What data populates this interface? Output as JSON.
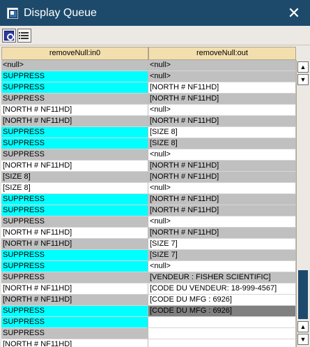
{
  "window": {
    "title": "Display Queue",
    "close_glyph": "✕"
  },
  "toolbar": {
    "buttons": [
      {
        "name": "refresh-icon"
      },
      {
        "name": "list-icon"
      }
    ]
  },
  "table": {
    "columns": [
      "removeNull:in0",
      "removeNull:out"
    ],
    "rows": [
      {
        "in": "<null>",
        "out": "<null>",
        "in_bg": "gray",
        "out_bg": "gray"
      },
      {
        "in": "SUPPRESS",
        "out": "<null>",
        "in_bg": "cyan",
        "out_bg": "gray"
      },
      {
        "in": "SUPPRESS",
        "out": "[NORTH # NF11HD]",
        "in_bg": "cyan",
        "out_bg": "white"
      },
      {
        "in": "SUPPRESS",
        "out": "[NORTH # NF11HD]",
        "in_bg": "gray",
        "out_bg": "gray"
      },
      {
        "in": "[NORTH # NF11HD]",
        "out": "<null>",
        "in_bg": "white",
        "out_bg": "white"
      },
      {
        "in": "[NORTH # NF11HD]",
        "out": "[NORTH # NF11HD]",
        "in_bg": "gray",
        "out_bg": "gray"
      },
      {
        "in": "SUPPRESS",
        "out": "[SIZE 8]",
        "in_bg": "cyan",
        "out_bg": "white"
      },
      {
        "in": "SUPPRESS",
        "out": "[SIZE 8]",
        "in_bg": "cyan",
        "out_bg": "gray"
      },
      {
        "in": "SUPPRESS",
        "out": "<null>",
        "in_bg": "gray",
        "out_bg": "white"
      },
      {
        "in": "[NORTH # NF11HD]",
        "out": "[NORTH # NF11HD]",
        "in_bg": "white",
        "out_bg": "gray"
      },
      {
        "in": "[SIZE 8]",
        "out": "[NORTH # NF11HD]",
        "in_bg": "gray",
        "out_bg": "gray"
      },
      {
        "in": "[SIZE 8]",
        "out": "<null>",
        "in_bg": "white",
        "out_bg": "white"
      },
      {
        "in": "SUPPRESS",
        "out": "[NORTH # NF11HD]",
        "in_bg": "cyan",
        "out_bg": "gray"
      },
      {
        "in": "SUPPRESS",
        "out": "[NORTH # NF11HD]",
        "in_bg": "cyan",
        "out_bg": "gray"
      },
      {
        "in": "SUPPRESS",
        "out": "<null>",
        "in_bg": "gray",
        "out_bg": "white"
      },
      {
        "in": "[NORTH # NF11HD]",
        "out": "[NORTH # NF11HD]",
        "in_bg": "white",
        "out_bg": "gray"
      },
      {
        "in": "[NORTH # NF11HD]",
        "out": "[SIZE 7]",
        "in_bg": "gray",
        "out_bg": "white"
      },
      {
        "in": "SUPPRESS",
        "out": "[SIZE 7]",
        "in_bg": "cyan",
        "out_bg": "gray"
      },
      {
        "in": "SUPPRESS",
        "out": "<null>",
        "in_bg": "cyan",
        "out_bg": "white"
      },
      {
        "in": "SUPPRESS",
        "out": "[VENDEUR : FISHER SCIENTIFIC]",
        "in_bg": "gray",
        "out_bg": "gray"
      },
      {
        "in": "[NORTH # NF11HD]",
        "out": "[CODE DU VENDEUR: 18-999-4567]",
        "in_bg": "white",
        "out_bg": "white"
      },
      {
        "in": "[NORTH # NF11HD]",
        "out": "[CODE DU MFG : 6926]",
        "in_bg": "gray",
        "out_bg": "white"
      },
      {
        "in": "SUPPRESS",
        "out": "[CODE DU MFG : 6926]",
        "in_bg": "cyan",
        "out_bg": "dark"
      },
      {
        "in": "SUPPRESS",
        "out": "",
        "in_bg": "cyan",
        "out_bg": "white"
      },
      {
        "in": "SUPPRESS",
        "out": "",
        "in_bg": "gray",
        "out_bg": "white"
      },
      {
        "in": "[NORTH # NF11HD]",
        "out": "",
        "in_bg": "white",
        "out_bg": "white"
      }
    ]
  },
  "scrollbar": {
    "up_glyph": "▲",
    "down_glyph": "▼"
  },
  "colors": {
    "titlebar": "#1d4a6b",
    "header": "#f3dfae",
    "cyan": "#00ffff",
    "gray": "#c0c0c0",
    "white": "#ffffff",
    "dark": "#808080"
  }
}
